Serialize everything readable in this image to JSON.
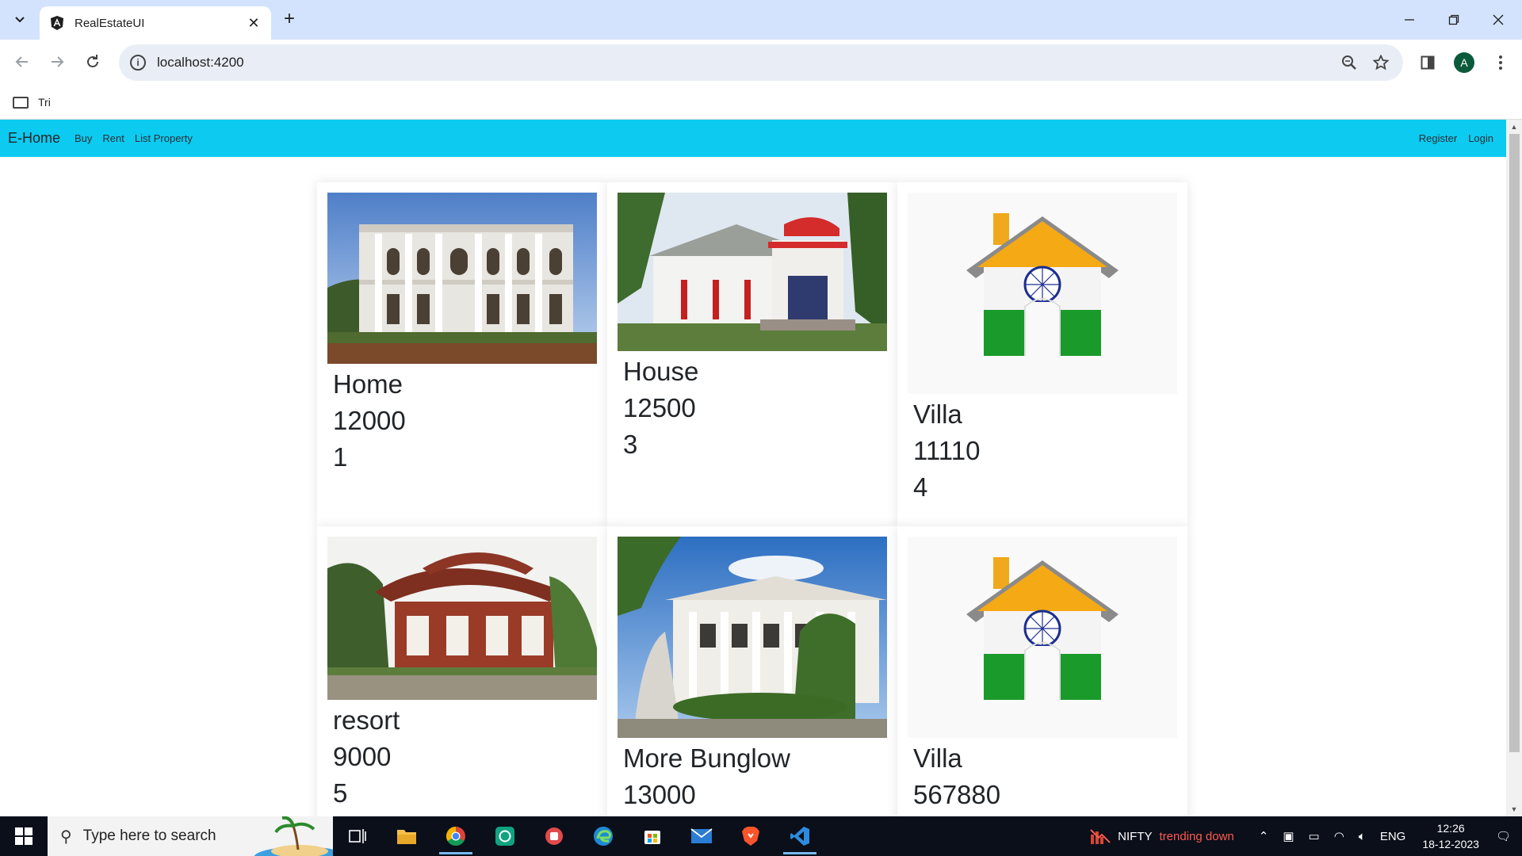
{
  "browser": {
    "tab_title": "RealEstateUI",
    "url": "localhost:4200",
    "bookmark_folder": "Tri",
    "profile_initial": "A"
  },
  "app": {
    "brand": "E-Home",
    "nav_links": [
      "Buy",
      "Rent",
      "List Property"
    ],
    "nav_right": [
      "Register",
      "Login"
    ]
  },
  "properties": [
    {
      "name": "Home",
      "price": "12000",
      "id": "1",
      "image": "white-mansion-photo"
    },
    {
      "name": "House",
      "price": "12500",
      "id": "3",
      "image": "red-white-house-photo"
    },
    {
      "name": "Villa",
      "price": "11110",
      "id": "4",
      "image": "india-flag-house-icon"
    },
    {
      "name": "resort",
      "price": "9000",
      "id": "5",
      "image": "pagoda-resort-photo"
    },
    {
      "name": "More Bunglow",
      "price": "13000",
      "id": "",
      "image": "palace-bunglow-photo"
    },
    {
      "name": "Villa",
      "price": "567880",
      "id": "",
      "image": "india-flag-house-icon"
    }
  ],
  "taskbar": {
    "search_placeholder": "Type here to search",
    "news_ticker": "NIFTY",
    "news_status": "trending down",
    "language": "ENG",
    "time": "12:26",
    "date": "18-12-2023"
  },
  "colors": {
    "navbar": "#0dcaf0",
    "tabstrip": "#d3e3fd",
    "news_down": "#ff5a4e"
  }
}
